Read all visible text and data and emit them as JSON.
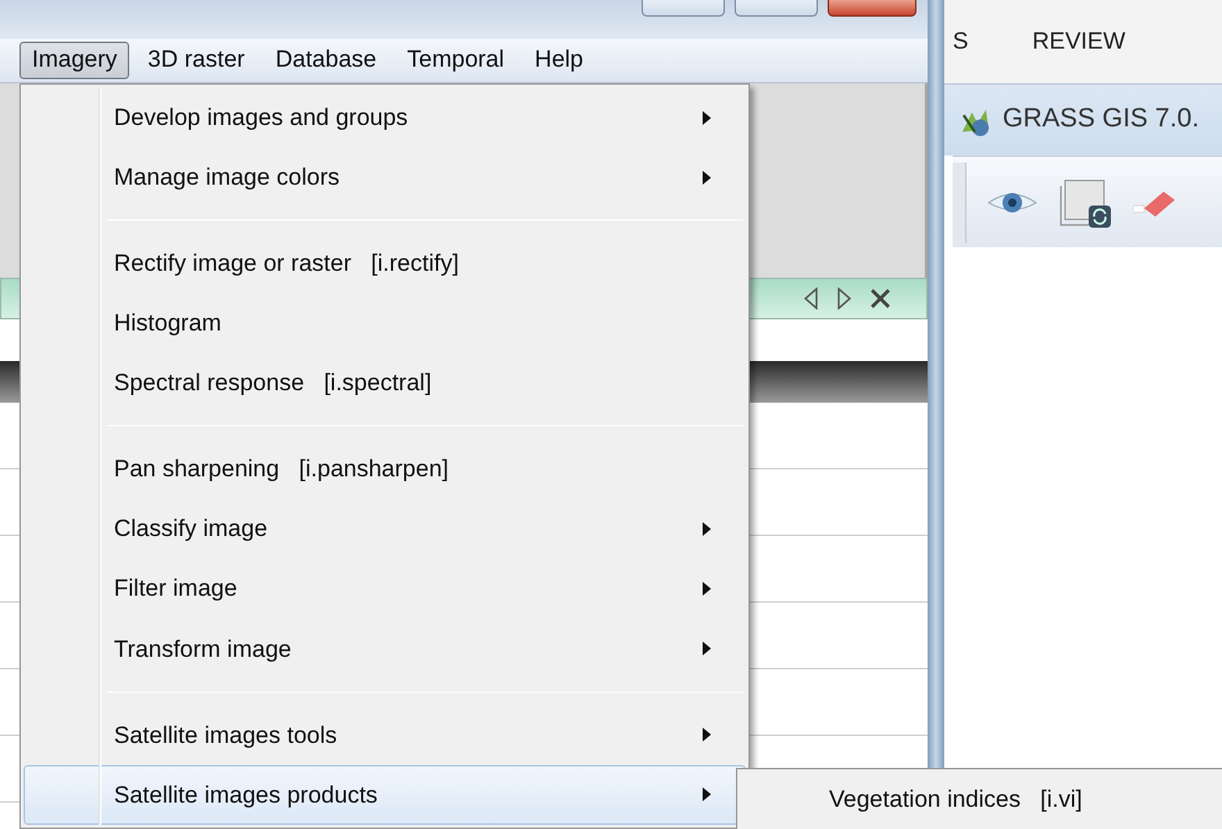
{
  "menubar": [
    {
      "label": "Imagery",
      "selected": true
    },
    {
      "label": "3D raster",
      "selected": false
    },
    {
      "label": "Database",
      "selected": false
    },
    {
      "label": "Temporal",
      "selected": false
    },
    {
      "label": "Help",
      "selected": false
    }
  ],
  "right_panel": {
    "tabs": [
      "S",
      "REVIEW"
    ],
    "window_title": "GRASS GIS 7.0."
  },
  "menu": {
    "items": [
      {
        "kind": "item",
        "label": "Develop images and groups",
        "submenu": true,
        "highlighted": false
      },
      {
        "kind": "item",
        "label": "Manage image colors",
        "submenu": true,
        "highlighted": false
      },
      {
        "kind": "separator"
      },
      {
        "kind": "item",
        "label": "Rectify image or raster",
        "command": "[i.rectify]",
        "submenu": false,
        "highlighted": false
      },
      {
        "kind": "item",
        "label": "Histogram",
        "submenu": false,
        "highlighted": false
      },
      {
        "kind": "item",
        "label": "Spectral response",
        "command": "[i.spectral]",
        "submenu": false,
        "highlighted": false
      },
      {
        "kind": "separator"
      },
      {
        "kind": "item",
        "label": "Pan sharpening",
        "command": "[i.pansharpen]",
        "submenu": false,
        "highlighted": false
      },
      {
        "kind": "item",
        "label": "Classify image",
        "submenu": true,
        "highlighted": false
      },
      {
        "kind": "item",
        "label": "Filter image",
        "submenu": true,
        "highlighted": false
      },
      {
        "kind": "item",
        "label": "Transform image",
        "submenu": true,
        "highlighted": false
      },
      {
        "kind": "separator"
      },
      {
        "kind": "item",
        "label": "Satellite images tools",
        "submenu": true,
        "highlighted": false
      },
      {
        "kind": "item",
        "label": "Satellite images products",
        "submenu": true,
        "highlighted": true
      }
    ]
  },
  "submenu": {
    "items": [
      {
        "label": "Vegetation indices",
        "command": "[i.vi]"
      }
    ]
  }
}
